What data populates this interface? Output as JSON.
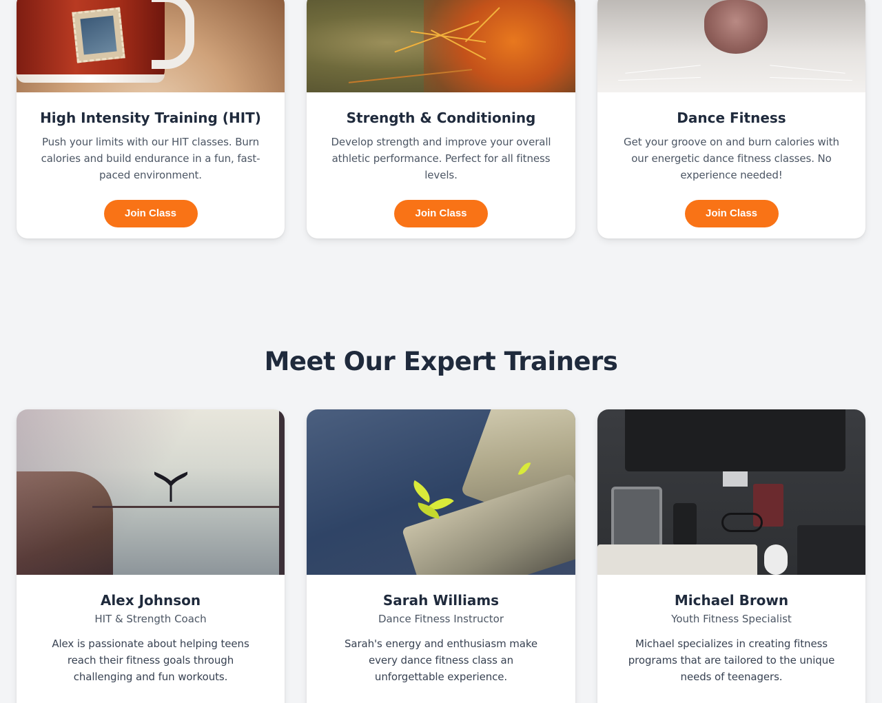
{
  "classes": {
    "items": [
      {
        "title": "High Intensity Training (HIT)",
        "description": "Push your limits with our HIT classes. Burn calories and build endurance in a fun, fast-paced environment.",
        "button_label": "Join Class",
        "image_icon": "mug-photo"
      },
      {
        "title": "Strength & Conditioning",
        "description": "Develop strength and improve your overall athletic performance. Perfect for all fitness levels.",
        "button_label": "Join Class",
        "image_icon": "cactus-photo"
      },
      {
        "title": "Dance Fitness",
        "description": "Get your groove on and burn calories with our energetic dance fitness classes. No experience needed!",
        "button_label": "Join Class",
        "image_icon": "cat-nose-photo"
      }
    ]
  },
  "trainers": {
    "heading": "Meet Our Expert Trainers",
    "items": [
      {
        "name": "Alex Johnson",
        "role": "HIT & Strength Coach",
        "bio": "Alex is passionate about helping teens reach their fitness goals through challenging and fun workouts.",
        "image_icon": "lake-bird-photo"
      },
      {
        "name": "Sarah Williams",
        "role": "Dance Fitness Instructor",
        "bio": "Sarah's energy and enthusiasm make every dance fitness class an unforgettable experience.",
        "image_icon": "rock-plant-photo"
      },
      {
        "name": "Michael Brown",
        "role": "Youth Fitness Specialist",
        "bio": "Michael specializes in creating fitness programs that are tailored to the unique needs of teenagers.",
        "image_icon": "desk-setup-photo"
      }
    ]
  },
  "colors": {
    "accent": "#f97316",
    "heading": "#1f2a3c",
    "text": "#4b5563",
    "background": "#f3f4f6"
  }
}
